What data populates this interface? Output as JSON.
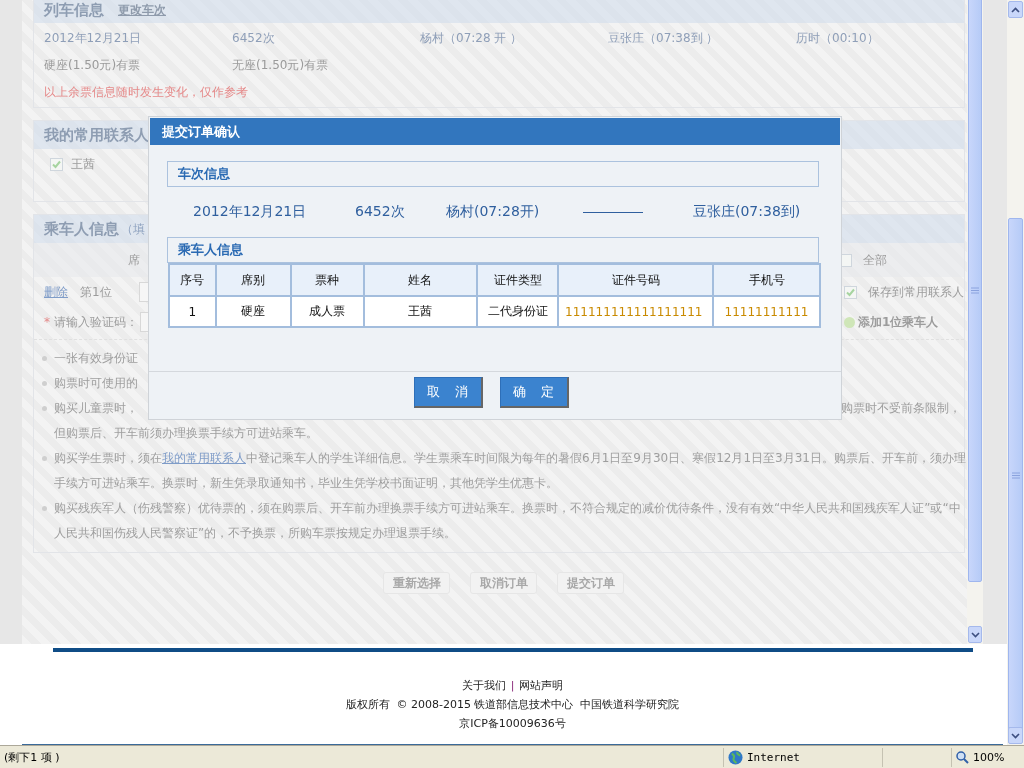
{
  "train_section": {
    "title": "列车信息",
    "change_link": "更改车次",
    "details": [
      "2012年12月21日",
      "6452次",
      "杨村（07:28 开 ）",
      "豆张庄（07:38到 ）",
      "历时（00:10）"
    ],
    "seats": [
      "硬座(1.50元)有票",
      "无座(1.50元)有票"
    ],
    "notice": "以上余票信息随时发生变化，仅作参考"
  },
  "contacts_section": {
    "title": "我的常用联系人",
    "contacts": [
      {
        "name": "王茜",
        "checked": true
      }
    ]
  },
  "passenger_section": {
    "title": "乘车人信息",
    "title_note": "（填",
    "column_header": "席",
    "select_all": {
      "label": "全部",
      "checked": false
    },
    "delete_link": "删除",
    "position": "第1位",
    "save_contact": {
      "label": "保存到常用联系人",
      "checked": true
    },
    "captcha_label": "请输入验证码：",
    "required_mark": "*",
    "add_passenger": "添加1位乘车人",
    "notes": [
      {
        "line1": "一张有效身份证"
      },
      {
        "line1": "购票时可使用的"
      },
      {
        "line1": "购买儿童票时，",
        "line1_right": "购票时不受前条限制，",
        "line2": "但购票后、开车前须办理换票手续方可进站乘车。"
      },
      {
        "line1": "购买学生票时，须在",
        "link": "我的常用联系人",
        "line1_rest": "中登记乘车人的学生详细信息。学生票乘车时间限为每年的暑假6月1日至9月30日、寒假12月1日至3月31日。购票后、开车前，须办理",
        "line2": "手续方可进站乘车。换票时，新生凭录取通知书，毕业生凭学校书面证明，其他凭学生优惠卡。"
      },
      {
        "line1": "购买残疾军人（伤残警察）优待票的，须在购票后、开车前办理换票手续方可进站乘车。换票时，不符合规定的减价优待条件，没有有效“中华人民共和国残疾军人证”或“中",
        "line2": "人民共和国伤残人民警察证”的，不予换票，所购车票按规定办理退票手续。"
      }
    ]
  },
  "page_buttons": [
    "重新选择",
    "取消订单",
    "提交订单"
  ],
  "dialog": {
    "title": "提交订单确认",
    "train_heading": "车次信息",
    "train": {
      "date": "2012年12月21日",
      "number": "6452次",
      "from": "杨村(07:28开)",
      "to": "豆张庄(07:38到)"
    },
    "passenger_heading": "乘车人信息",
    "columns": [
      "序号",
      "席别",
      "票种",
      "姓名",
      "证件类型",
      "证件号码",
      "手机号"
    ],
    "rows": [
      [
        "1",
        "硬座",
        "成人票",
        "王茜",
        "二代身份证",
        "111111111111111111",
        "11111111111"
      ]
    ],
    "buttons": [
      "取　消",
      "确　定"
    ]
  },
  "footer": {
    "links": [
      "关于我们",
      "网站声明"
    ],
    "separator": "|",
    "copyright": "版权所有  © 2008-2015 铁道部信息技术中心  中国铁道科学研究院",
    "icp": "京ICP备10009636号"
  },
  "status_bar": {
    "text": "(剩下1 项 )",
    "zone": "Internet",
    "zoom": "100%"
  }
}
